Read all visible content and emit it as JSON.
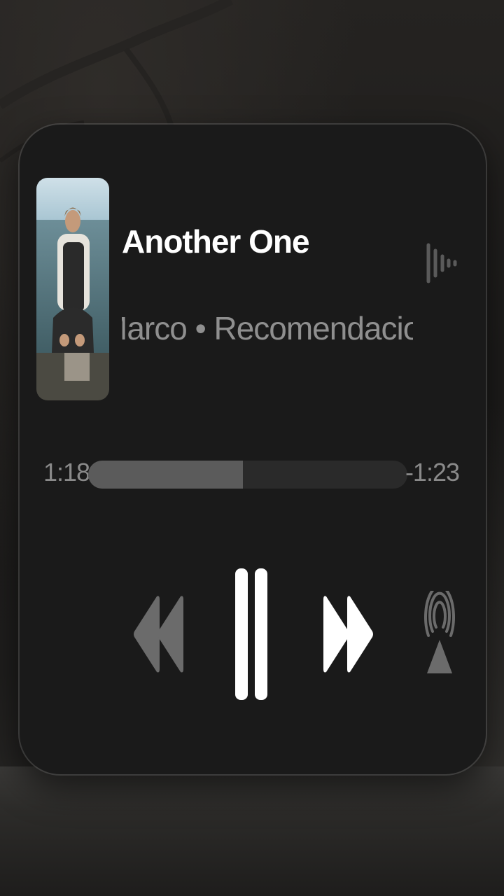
{
  "now_playing": {
    "title": "Another One",
    "subtitle": "Marco • Recomendaciones para ti",
    "artwork": "album-art-photo"
  },
  "playback": {
    "elapsed": "1:18",
    "remaining": "-1:23",
    "progress_fraction": 0.485,
    "state": "playing"
  },
  "controls": {
    "previous_icon": "rewind-icon",
    "play_pause_icon": "pause-icon",
    "next_icon": "fast-forward-icon",
    "output_icon": "airplay-icon",
    "visualizer_icon": "waveform-icon"
  },
  "colors": {
    "card": "#1a1a1a",
    "title": "#ffffff",
    "subtitle": "#8f8f8f",
    "progress_track": "#2a2a2a",
    "progress_fill": "#5b5b5b",
    "dim_control": "#6b6b6b"
  }
}
